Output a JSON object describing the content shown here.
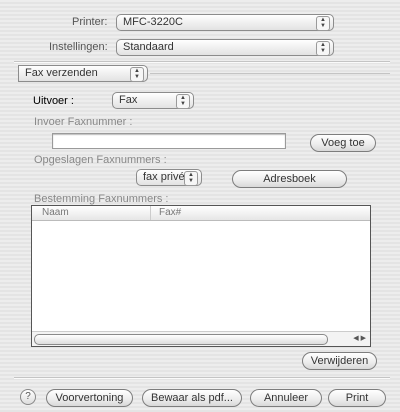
{
  "printer": {
    "label": "Printer:",
    "value": "MFC-3220C"
  },
  "settings": {
    "label": "Instellingen:",
    "value": "Standaard"
  },
  "panel": {
    "value": "Fax verzenden"
  },
  "output": {
    "label": "Uitvoer :",
    "value": "Fax"
  },
  "fax_input": {
    "label": "Invoer Faxnummer :",
    "value": "",
    "add_button": "Voeg toe"
  },
  "saved": {
    "label": "Opgeslagen Faxnummers :",
    "value": "fax privé",
    "addressbook_button": "Adresboek"
  },
  "destination": {
    "label": "Bestemming Faxnummers :",
    "columns": [
      "Naam",
      "Fax#"
    ],
    "rows": [],
    "remove_button": "Verwijderen"
  },
  "footer": {
    "help": "?",
    "preview": "Voorvertoning",
    "save_pdf": "Bewaar als pdf...",
    "cancel": "Annuleer",
    "print": "Print"
  },
  "icons": {
    "popup_arrows": "updown-arrows-icon",
    "help": "question-mark-icon",
    "scroll": "scroll-arrows-icon"
  }
}
